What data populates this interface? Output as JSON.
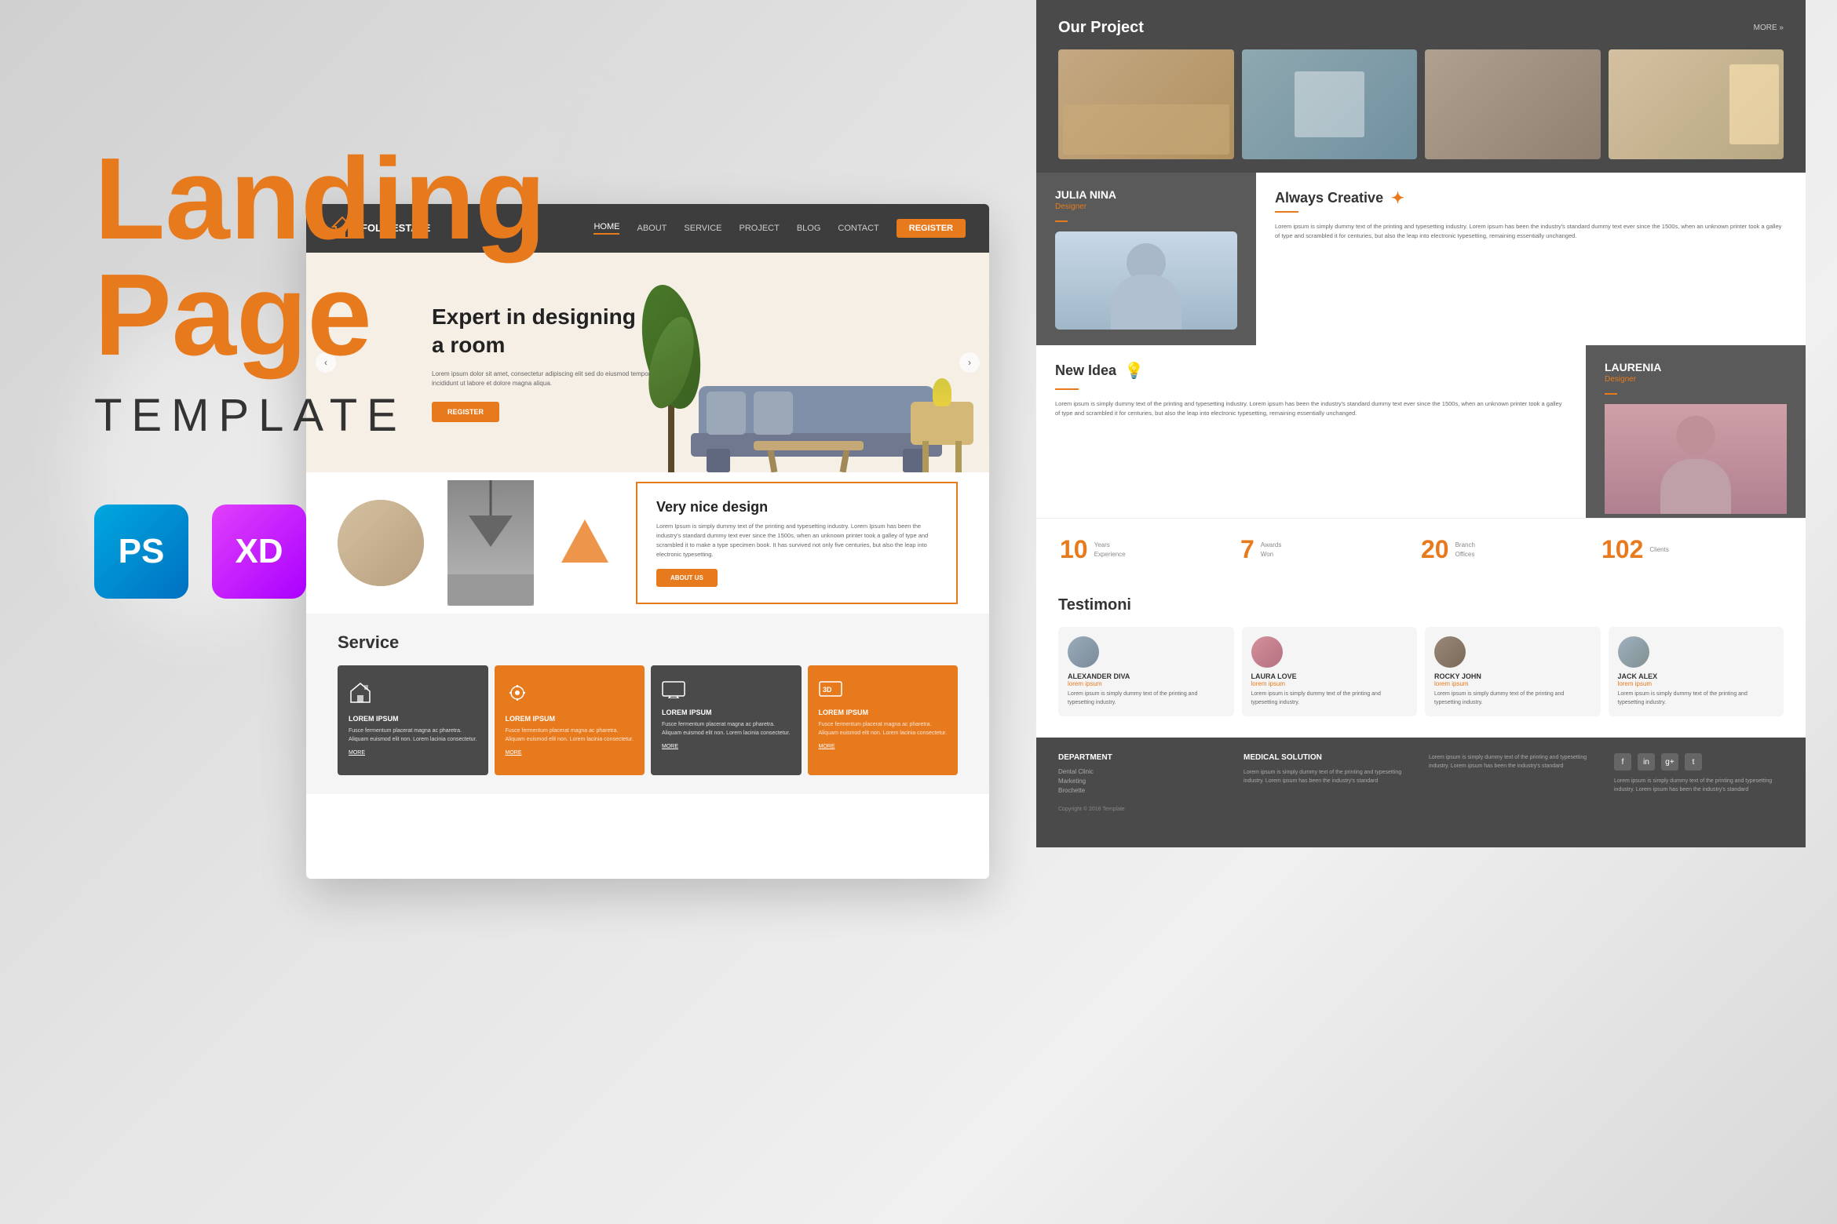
{
  "page": {
    "title": "Landing Page Template",
    "title_line1": "Landing",
    "title_line2": "Page",
    "subtitle": "TEMPLATE",
    "tools": [
      "PS",
      "XD"
    ]
  },
  "navbar": {
    "logo_name": "FOLK ESTATE",
    "links": [
      "HOME",
      "ABOUT",
      "SERVICE",
      "PROJECT",
      "BLOG",
      "CONTACT"
    ],
    "active_link": "HOME",
    "cta_button": "REGISTER"
  },
  "hero": {
    "title": "Expert in designing a room",
    "body_text": "Lorem ipsum dolor sit amet, consectetur adipiscing elit sed do eiusmod tempor incididunt ut labore et dolore magna aliqua.",
    "cta_button": "REGISTER",
    "prev_label": "‹",
    "next_label": "›"
  },
  "about": {
    "title": "Very nice design",
    "body_text": "Lorem Ipsum is simply dummy text of the printing and typesetting industry. Lorem Ipsum has been the industry's standard dummy text ever since the 1500s, when an unknown printer took a galley of type and scrambled it to make a type specimen book. It has survived not only five centuries, but also the leap into electronic typesetting.",
    "cta_button": "ABOUT US"
  },
  "service": {
    "title": "Service",
    "cards": [
      {
        "title": "LOREM IPSUM",
        "text": "Fusce fermentum placerat magna ac pharetra. Aliquam euismod elit non. Lorem lacinia consectetur.",
        "more": "MORE",
        "style": "dark"
      },
      {
        "title": "LOREM IPSUM",
        "text": "Fusce fermentum placerat magna ac pharetra. Aliquam euismod elit non. Lorem lacinia consectetur.",
        "more": "MORE",
        "style": "orange"
      },
      {
        "title": "LOREM IPSUM",
        "text": "Fusce fermentum placerat magna ac pharetra. Aliquam euismod elit non. Lorem lacinia consectetur.",
        "more": "MORE",
        "style": "dark"
      },
      {
        "title": "LOREM IPSUM",
        "text": "Fusce fermentum placerat magna ac pharetra. Aliquam euismod elit non. Lorem lacinia consectetur.",
        "more": "MORE",
        "style": "orange"
      }
    ]
  },
  "our_project": {
    "title": "Our Project",
    "more_label": "MORE »"
  },
  "team": {
    "members": [
      {
        "name": "JULIA NINA",
        "role": "Designer"
      },
      {
        "name": "LAURENIA",
        "role": "Designer"
      }
    ],
    "creative_title": "Always Creative",
    "creative_text": "Lorem ipsum is simply dummy text of the printing and typesetting industry. Lorem ipsum has been the industry's standard dummy text ever since the 1500s, when an unknown printer took a galley of type and scrambled it for centuries, but also the leap into electronic typesetting, remaining essentially unchanged.",
    "idea_title": "New Idea",
    "idea_text": "Lorem ipsum is simply dummy text of the printing and typesetting industry. Lorem ipsum has been the industry's standard dummy text ever since the 1500s, when an unknown printer took a galley of type and scrambled it for centuries, but also the leap into electronic typesetting, remaining essentially unchanged."
  },
  "stats": [
    {
      "number": "10",
      "label": "Years\nExperience"
    },
    {
      "number": "7",
      "label": "Awards\nWon"
    },
    {
      "number": "20",
      "label": "Branch\nOffices"
    },
    {
      "number": "102",
      "label": "Clients"
    }
  ],
  "testimoni": {
    "title": "Testimoni",
    "cards": [
      {
        "name": "ALEXANDER DIVA",
        "role": "lorem ipsum",
        "text": "Lorem ipsum is simply dummy text of the printing and typesetting industry."
      },
      {
        "name": "LAURA LOVE",
        "role": "lorem ipsum",
        "text": "Lorem ipsum is simply dummy text of the printing and typesetting industry."
      },
      {
        "name": "ROCKY JOHN",
        "role": "lorem ipsum",
        "text": "Lorem ipsum is simply dummy text of the printing and typesetting industry."
      },
      {
        "name": "JACK ALEX",
        "role": "lorem ipsum",
        "text": "Lorem ipsum is simply dummy text of the printing and typesetting industry."
      }
    ]
  },
  "footer": {
    "columns": [
      {
        "title": "DEPARTMENT",
        "items": [
          "Dental Clinic",
          "Marketing",
          "Brochette"
        ]
      },
      {
        "title": "MEDICAL SOLUTION",
        "text": "Lorem ipsum is simply dummy text of the printing and typesetting industry. Lorem ipsum has been the industry's standard"
      },
      {
        "title": "",
        "text": "Lorem ipsum is simply dummy text of the printing and typesetting industry. Lorem ipsum has been the industry's standard"
      },
      {
        "title": "",
        "social": [
          "f",
          "in",
          "g+",
          "t"
        ],
        "text": "Lorem ipsum is simply dummy text of the printing and typesetting industry. Lorem ipsum has been the industry's standard"
      }
    ],
    "copyright": "Copyright © 2016 Template"
  },
  "colors": {
    "orange": "#E87A1E",
    "dark": "#4a4a4a",
    "medium": "#5a5a5a",
    "light": "#f5f5f5"
  }
}
